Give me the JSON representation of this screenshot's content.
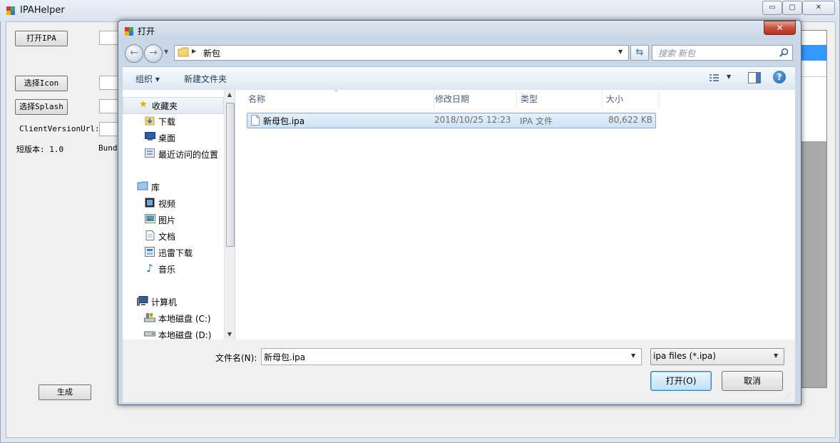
{
  "main_window": {
    "title": "IPAHelper",
    "buttons": {
      "open_ipa": "打开IPA",
      "select_icon": "选择Icon",
      "select_splash": "选择Splash",
      "generate": "生成"
    },
    "labels": {
      "client_version_url": "ClientVersionUrl:",
      "short_version": "短版本: 1.0",
      "bundle_partial": "Bund"
    },
    "window_controls": {
      "minimize": "▭",
      "maximize": "▢",
      "close": "✕"
    }
  },
  "dialog": {
    "title": "打开",
    "close": "✕",
    "address": {
      "path": "新包"
    },
    "search": {
      "placeholder": "搜索 新包"
    },
    "toolbar": {
      "organize": "组织 ▾",
      "new_folder": "新建文件夹"
    },
    "nav": {
      "favorites": [
        {
          "label": "收藏夹",
          "icon": "star-icon"
        },
        {
          "label": "下载",
          "icon": "download-folder-icon"
        },
        {
          "label": "桌面",
          "icon": "desktop-icon"
        },
        {
          "label": "最近访问的位置",
          "icon": "recent-places-icon"
        }
      ],
      "libraries": [
        {
          "label": "库",
          "icon": "library-icon"
        },
        {
          "label": "视频",
          "icon": "video-icon"
        },
        {
          "label": "图片",
          "icon": "picture-icon"
        },
        {
          "label": "文档",
          "icon": "document-icon"
        },
        {
          "label": "迅雷下载",
          "icon": "xunlei-icon"
        },
        {
          "label": "音乐",
          "icon": "music-icon"
        }
      ],
      "computer": [
        {
          "label": "计算机",
          "icon": "computer-icon"
        },
        {
          "label": "本地磁盘 (C:)",
          "icon": "disk-c-icon"
        },
        {
          "label": "本地磁盘 (D:)",
          "icon": "disk-d-icon"
        }
      ]
    },
    "columns": [
      "名称",
      "修改日期",
      "类型",
      "大小"
    ],
    "files": [
      {
        "name": "新母包.ipa",
        "date": "2018/10/25 12:23",
        "type": "IPA 文件",
        "size": "80,622 KB"
      }
    ],
    "filename_label": "文件名(N):",
    "filename_value": "新母包.ipa",
    "filetype": "ipa files (*.ipa)",
    "open_button": "打开(O)",
    "cancel_button": "取消"
  }
}
